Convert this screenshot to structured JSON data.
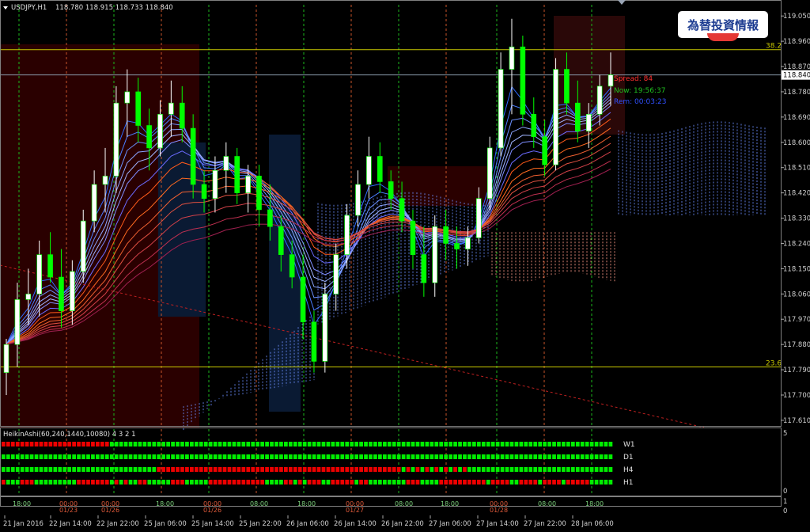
{
  "chart_data": {
    "type": "candlestick",
    "header": {
      "symbol_tf": "USDJPY,H1",
      "ohlc": "118.780 118.915 118.733 118.840"
    },
    "price_axis": {
      "ticks": [
        "119.050",
        "118.960",
        "118.870",
        "118.780",
        "118.690",
        "118.600",
        "118.510",
        "118.420",
        "118.330",
        "118.240",
        "118.150",
        "118.060",
        "117.970",
        "117.880",
        "117.790",
        "117.700",
        "117.610"
      ],
      "range": [
        117.59,
        119.09
      ]
    },
    "current_price": "118.840",
    "fib_levels": [
      {
        "label": "38.2",
        "price": 118.93
      },
      {
        "label": "23.6",
        "price": 117.8
      }
    ],
    "info": {
      "spread": "Spread: 84",
      "now": "Now: 19:56:37",
      "rem": "Rem: 00:03:23"
    },
    "time_axis_labels": [
      "21 Jan 2016",
      "22 Jan 14:00",
      "22 Jan 22:00",
      "25 Jan 06:00",
      "25 Jan 14:00",
      "25 Jan 22:00",
      "26 Jan 06:00",
      "26 Jan 14:00",
      "26 Jan 22:00",
      "27 Jan 06:00",
      "27 Jan 14:00",
      "27 Jan 22:00",
      "28 Jan 06:00"
    ],
    "time_markers": [
      "18:00",
      "00:00",
      "01/23",
      "00:00",
      "01/26",
      "18:00",
      "00:00",
      "01/26",
      "08:00",
      "18:00",
      "00:00",
      "01/27",
      "08:00",
      "18:00",
      "00:00",
      "01/28",
      "08:00",
      "18:00"
    ],
    "candles": [
      {
        "o": 117.78,
        "h": 117.9,
        "l": 117.7,
        "c": 117.88,
        "d": "up"
      },
      {
        "o": 117.88,
        "h": 118.1,
        "l": 117.8,
        "c": 118.04,
        "d": "up"
      },
      {
        "o": 118.04,
        "h": 118.15,
        "l": 117.95,
        "c": 118.06,
        "d": "up"
      },
      {
        "o": 118.06,
        "h": 118.25,
        "l": 117.98,
        "c": 118.2,
        "d": "up"
      },
      {
        "o": 118.2,
        "h": 118.28,
        "l": 118.1,
        "c": 118.12,
        "d": "dn"
      },
      {
        "o": 118.12,
        "h": 118.22,
        "l": 117.94,
        "c": 118.0,
        "d": "dn"
      },
      {
        "o": 118.0,
        "h": 118.18,
        "l": 117.95,
        "c": 118.14,
        "d": "up"
      },
      {
        "o": 118.14,
        "h": 118.36,
        "l": 118.1,
        "c": 118.32,
        "d": "up"
      },
      {
        "o": 118.32,
        "h": 118.5,
        "l": 118.28,
        "c": 118.45,
        "d": "up"
      },
      {
        "o": 118.45,
        "h": 118.58,
        "l": 118.35,
        "c": 118.48,
        "d": "up"
      },
      {
        "o": 118.48,
        "h": 118.8,
        "l": 118.42,
        "c": 118.74,
        "d": "up"
      },
      {
        "o": 118.74,
        "h": 118.86,
        "l": 118.62,
        "c": 118.78,
        "d": "up"
      },
      {
        "o": 118.78,
        "h": 118.83,
        "l": 118.6,
        "c": 118.66,
        "d": "dn"
      },
      {
        "o": 118.66,
        "h": 118.72,
        "l": 118.5,
        "c": 118.58,
        "d": "dn"
      },
      {
        "o": 118.58,
        "h": 118.75,
        "l": 118.55,
        "c": 118.7,
        "d": "up"
      },
      {
        "o": 118.7,
        "h": 118.82,
        "l": 118.62,
        "c": 118.74,
        "d": "up"
      },
      {
        "o": 118.74,
        "h": 118.8,
        "l": 118.6,
        "c": 118.65,
        "d": "dn"
      },
      {
        "o": 118.65,
        "h": 118.7,
        "l": 118.4,
        "c": 118.45,
        "d": "dn"
      },
      {
        "o": 118.45,
        "h": 118.5,
        "l": 118.35,
        "c": 118.4,
        "d": "dn"
      },
      {
        "o": 118.4,
        "h": 118.55,
        "l": 118.35,
        "c": 118.5,
        "d": "up"
      },
      {
        "o": 118.5,
        "h": 118.6,
        "l": 118.42,
        "c": 118.55,
        "d": "up"
      },
      {
        "o": 118.55,
        "h": 118.58,
        "l": 118.38,
        "c": 118.42,
        "d": "dn"
      },
      {
        "o": 118.42,
        "h": 118.52,
        "l": 118.35,
        "c": 118.48,
        "d": "up"
      },
      {
        "o": 118.48,
        "h": 118.52,
        "l": 118.3,
        "c": 118.36,
        "d": "dn"
      },
      {
        "o": 118.36,
        "h": 118.45,
        "l": 118.25,
        "c": 118.3,
        "d": "dn"
      },
      {
        "o": 118.3,
        "h": 118.34,
        "l": 118.14,
        "c": 118.2,
        "d": "dn"
      },
      {
        "o": 118.2,
        "h": 118.25,
        "l": 118.08,
        "c": 118.12,
        "d": "dn"
      },
      {
        "o": 118.12,
        "h": 118.2,
        "l": 117.9,
        "c": 117.96,
        "d": "dn"
      },
      {
        "o": 117.96,
        "h": 118.0,
        "l": 117.78,
        "c": 117.82,
        "d": "dn"
      },
      {
        "o": 117.82,
        "h": 118.1,
        "l": 117.78,
        "c": 118.06,
        "d": "up"
      },
      {
        "o": 118.06,
        "h": 118.24,
        "l": 118.0,
        "c": 118.2,
        "d": "up"
      },
      {
        "o": 118.2,
        "h": 118.38,
        "l": 118.15,
        "c": 118.34,
        "d": "up"
      },
      {
        "o": 118.34,
        "h": 118.5,
        "l": 118.3,
        "c": 118.45,
        "d": "up"
      },
      {
        "o": 118.45,
        "h": 118.62,
        "l": 118.4,
        "c": 118.55,
        "d": "up"
      },
      {
        "o": 118.55,
        "h": 118.6,
        "l": 118.42,
        "c": 118.46,
        "d": "dn"
      },
      {
        "o": 118.46,
        "h": 118.5,
        "l": 118.36,
        "c": 118.4,
        "d": "dn"
      },
      {
        "o": 118.4,
        "h": 118.46,
        "l": 118.28,
        "c": 118.32,
        "d": "dn"
      },
      {
        "o": 118.32,
        "h": 118.36,
        "l": 118.15,
        "c": 118.2,
        "d": "dn"
      },
      {
        "o": 118.2,
        "h": 118.3,
        "l": 118.05,
        "c": 118.1,
        "d": "dn"
      },
      {
        "o": 118.1,
        "h": 118.34,
        "l": 118.05,
        "c": 118.3,
        "d": "up"
      },
      {
        "o": 118.3,
        "h": 118.36,
        "l": 118.18,
        "c": 118.24,
        "d": "dn"
      },
      {
        "o": 118.24,
        "h": 118.3,
        "l": 118.15,
        "c": 118.22,
        "d": "dn"
      },
      {
        "o": 118.22,
        "h": 118.3,
        "l": 118.16,
        "c": 118.26,
        "d": "up"
      },
      {
        "o": 118.26,
        "h": 118.44,
        "l": 118.24,
        "c": 118.4,
        "d": "up"
      },
      {
        "o": 118.4,
        "h": 118.62,
        "l": 118.36,
        "c": 118.58,
        "d": "up"
      },
      {
        "o": 118.58,
        "h": 118.92,
        "l": 118.55,
        "c": 118.86,
        "d": "up"
      },
      {
        "o": 118.86,
        "h": 119.04,
        "l": 118.7,
        "c": 118.94,
        "d": "up"
      },
      {
        "o": 118.94,
        "h": 118.98,
        "l": 118.66,
        "c": 118.7,
        "d": "dn"
      },
      {
        "o": 118.7,
        "h": 118.76,
        "l": 118.58,
        "c": 118.62,
        "d": "dn"
      },
      {
        "o": 118.62,
        "h": 118.68,
        "l": 118.48,
        "c": 118.52,
        "d": "dn"
      },
      {
        "o": 118.52,
        "h": 118.9,
        "l": 118.5,
        "c": 118.86,
        "d": "up"
      },
      {
        "o": 118.86,
        "h": 118.92,
        "l": 118.7,
        "c": 118.74,
        "d": "dn"
      },
      {
        "o": 118.74,
        "h": 118.82,
        "l": 118.6,
        "c": 118.64,
        "d": "dn"
      },
      {
        "o": 118.64,
        "h": 118.74,
        "l": 118.58,
        "c": 118.7,
        "d": "up"
      },
      {
        "o": 118.7,
        "h": 118.84,
        "l": 118.66,
        "c": 118.8,
        "d": "up"
      },
      {
        "o": 118.8,
        "h": 118.92,
        "l": 118.73,
        "c": 118.84,
        "d": "up"
      }
    ],
    "indicator": {
      "title": "HeikinAshi(60,240,1440,10080) 4 3 2 1",
      "scale_top": "5",
      "scale_bottom": "0",
      "rows": [
        "W1",
        "D1",
        "H4",
        "H1"
      ],
      "lower_ticks": [
        "1",
        "0"
      ]
    }
  },
  "badge_text": "為替投資情報",
  "colors": {
    "up": "#ffffff",
    "dn": "#00ff00",
    "grid_v": "#e06030",
    "grid_g": "#00c000",
    "fib": "#c8c800",
    "ha_up": "#00ee00",
    "ha_dn": "#ee0000"
  }
}
